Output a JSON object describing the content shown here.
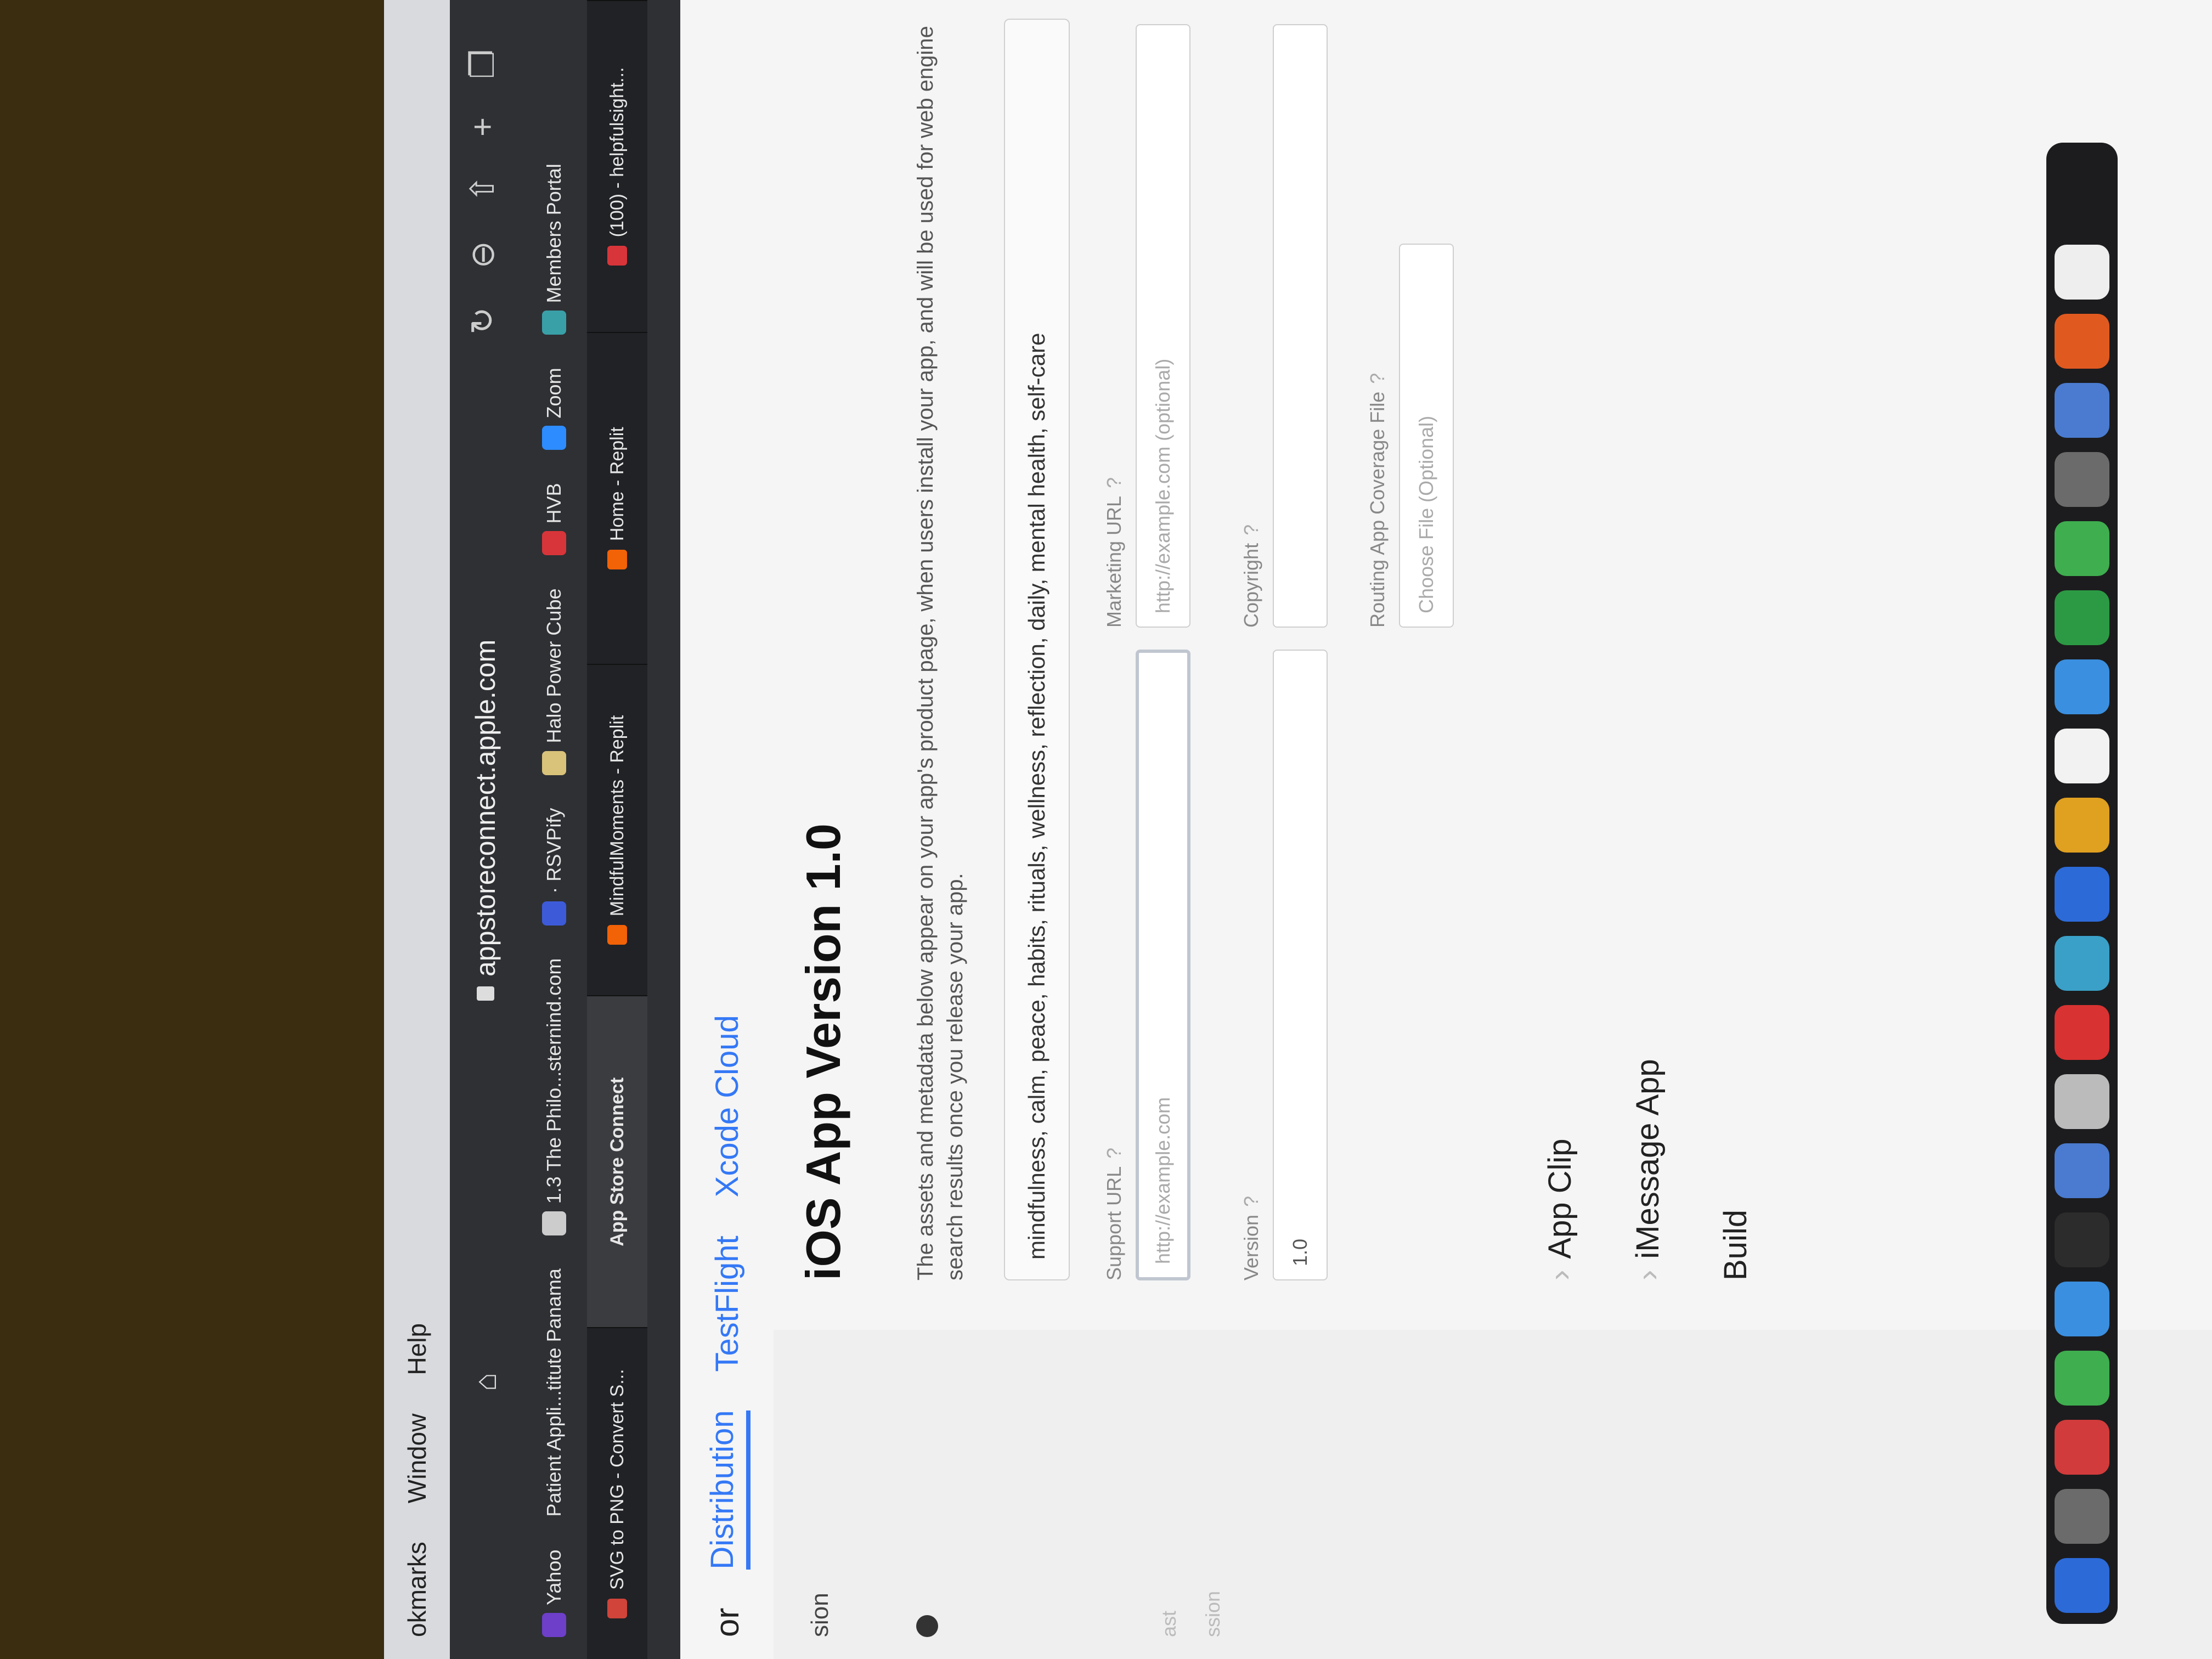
{
  "menubar": {
    "items": [
      "okmarks",
      "Window",
      "Help"
    ]
  },
  "browser": {
    "address": "appstoreconnect.apple.com",
    "bookmarks": [
      {
        "label": "Yahoo",
        "color": "#6e3fc9"
      },
      {
        "label": "Patient Appli...titute Panama",
        "color": "#888888"
      },
      {
        "label": "1.3 The Philo...sternind.com",
        "color": "#cccccc"
      },
      {
        "label": "· RSVPify",
        "color": "#3d5bd8"
      },
      {
        "label": "Halo Power Cube",
        "color": "#d9c27a"
      },
      {
        "label": "HVB",
        "color": "#d8353a"
      },
      {
        "label": "Zoom",
        "color": "#2d8cff"
      },
      {
        "label": "Members Portal",
        "color": "#3aa0a8"
      }
    ],
    "tabs": [
      {
        "label": "SVG to PNG - Convert S...",
        "color": "#d0443a",
        "active": false
      },
      {
        "label": "App Store Connect",
        "color": "",
        "active": true
      },
      {
        "label": "MindfulMoments - Replit",
        "color": "#f26207",
        "active": false
      },
      {
        "label": "Home - Replit",
        "color": "#f26207",
        "active": false
      },
      {
        "label": "(100) - helpfulsight...",
        "color": "#d8353a",
        "active": false
      }
    ]
  },
  "app_nav": {
    "brand": "or",
    "tabs": [
      {
        "label": "Distribution",
        "active": true
      },
      {
        "label": "TestFlight",
        "active": false
      },
      {
        "label": "Xcode Cloud",
        "active": false
      }
    ]
  },
  "sidebar": {
    "version_label": "sion",
    "faint_1": "ast",
    "faint_2": "ssion"
  },
  "main": {
    "title": "iOS App Version 1.0",
    "description": "The assets and metadata below appear on your app's product page, when users install your app, and will be used for web engine search results once you release your app.",
    "keywords": "mindfulness, calm, peace, habits, rituals, wellness, reflection, daily, mental health, self-care",
    "support_url": {
      "label": "Support URL",
      "placeholder": "http://example.com"
    },
    "marketing_url": {
      "label": "Marketing URL",
      "placeholder": "http://example.com (optional)"
    },
    "version": {
      "label": "Version",
      "value": "1.0"
    },
    "copyright": {
      "label": "Copyright",
      "value": ""
    },
    "routing": {
      "label": "Routing App Coverage File",
      "placeholder": "Choose File (Optional)"
    },
    "sections": [
      "App Clip",
      "iMessage App",
      "Build"
    ]
  },
  "dock": {
    "icons": [
      "#2c6ad8",
      "#6b6b6b",
      "#d23b3b",
      "#3fae4f",
      "#3b8fe0",
      "#2c2c2c",
      "#4a7bd0",
      "#bbbbbb",
      "#d83232",
      "#3aa0c8",
      "#2c6ad8",
      "#e0a020",
      "#f2f2f2",
      "#3b8fe0",
      "#2c9a44",
      "#3fae4f",
      "#6b6b6b",
      "#4a7bd0",
      "#e05a20",
      "#eeeeee"
    ]
  }
}
